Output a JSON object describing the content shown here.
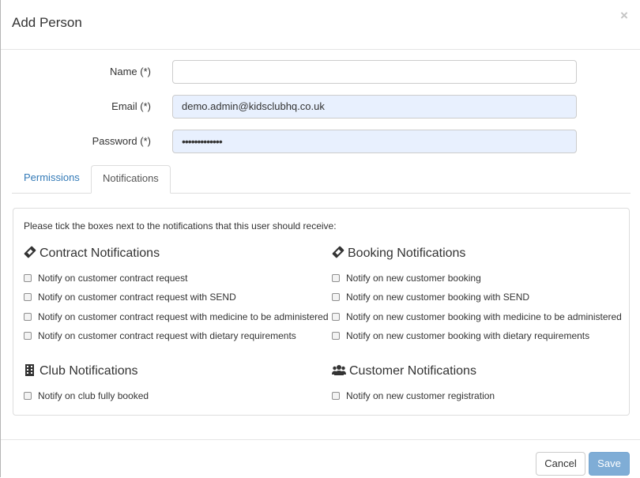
{
  "modal": {
    "title": "Add Person",
    "close_symbol": "×"
  },
  "form": {
    "name_label": "Name (*)",
    "name_value": "",
    "email_label": "Email (*)",
    "email_value": "demo.admin@kidsclubhq.co.uk",
    "password_label": "Password (*)",
    "password_value": "•••••••••••••"
  },
  "tabs": [
    {
      "label": "Permissions",
      "active": false
    },
    {
      "label": "Notifications",
      "active": true
    }
  ],
  "notifications": {
    "intro": "Please tick the boxes next to the notifications that this user should receive:",
    "contract": {
      "heading": "Contract Notifications",
      "icon": "ticket-icon",
      "items": [
        "Notify on customer contract request",
        "Notify on customer contract request with SEND",
        "Notify on customer contract request with medicine to be administered",
        "Notify on customer contract request with dietary requirements"
      ]
    },
    "booking": {
      "heading": "Booking Notifications",
      "icon": "ticket-icon",
      "items": [
        "Notify on new customer booking",
        "Notify on new customer booking with SEND",
        "Notify on new customer booking with medicine to be administered",
        "Notify on new customer booking with dietary requirements"
      ]
    },
    "club": {
      "heading": "Club Notifications",
      "icon": "building-icon",
      "items": [
        "Notify on club fully booked"
      ]
    },
    "customer": {
      "heading": "Customer Notifications",
      "icon": "users-icon",
      "items": [
        "Notify on new customer registration"
      ]
    }
  },
  "footer": {
    "cancel_label": "Cancel",
    "save_label": "Save"
  },
  "colors": {
    "link": "#337ab7",
    "save_button": "#7fadd6",
    "autofill_background": "#e8f0fe"
  }
}
